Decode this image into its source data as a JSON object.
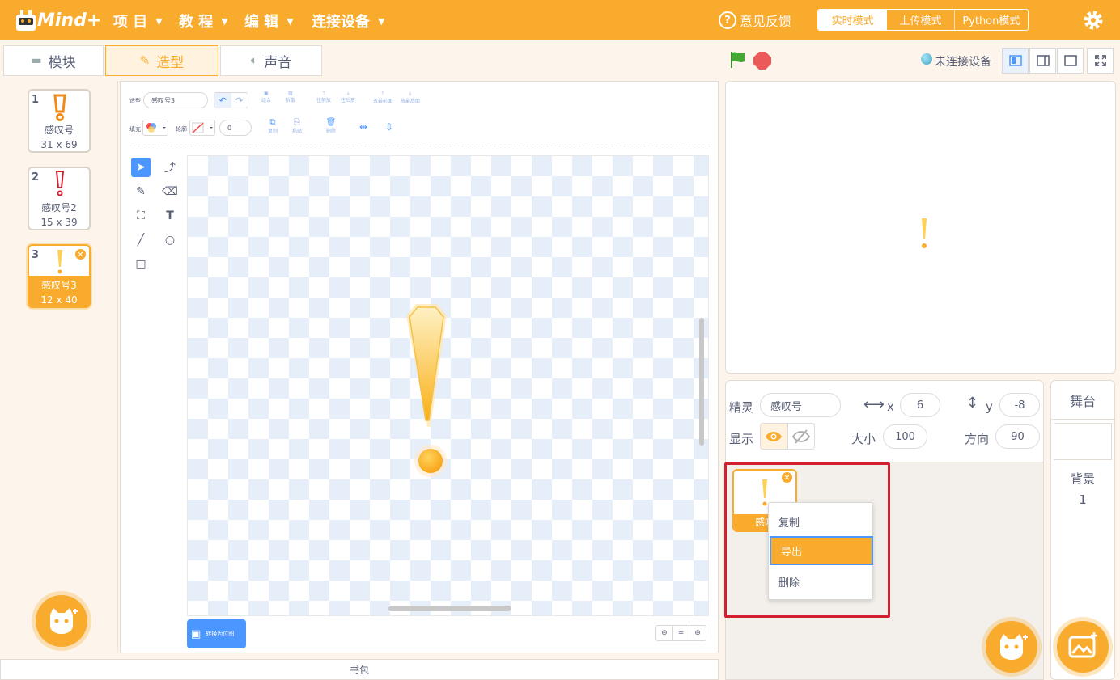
{
  "topbar": {
    "logo_text": "Mind+",
    "menus": [
      "项 目",
      "教 程",
      "编 辑",
      "连接设备"
    ],
    "feedback": "意见反馈",
    "modes": [
      "实时模式",
      "上传模式",
      "Python模式"
    ]
  },
  "tabs": {
    "blocks": "模块",
    "costumes": "造型",
    "sounds": "声音"
  },
  "costumes": [
    {
      "num": "1",
      "name": "感叹号",
      "size": "31 x 69"
    },
    {
      "num": "2",
      "name": "感叹号2",
      "size": "15 x 39"
    },
    {
      "num": "3",
      "name": "感叹号3",
      "size": "12 x 40"
    }
  ],
  "editor": {
    "costume_label": "造型",
    "costume_name": "感叹号3",
    "fill_label": "填充",
    "outline_label": "轮廓",
    "outline_width": "0",
    "group_label": "组合",
    "ungroup_label": "拆散",
    "forward_label": "往前放",
    "backward_label": "往后放",
    "front_label": "放最前面",
    "back_label": "放最后面",
    "copy_label": "复制",
    "paste_label": "粘贴",
    "delete_label": "删除",
    "convert_bitmap": "转换为位图"
  },
  "stage_header": {
    "connection": "未连接设备"
  },
  "sprite_info": {
    "sprite_label": "精灵",
    "sprite_name": "感叹号",
    "x_label": "x",
    "x_value": "6",
    "y_label": "y",
    "y_value": "-8",
    "show_label": "显示",
    "size_label": "大小",
    "size_value": "100",
    "direction_label": "方向",
    "direction_value": "90"
  },
  "sprite_tile": {
    "name": "感叹"
  },
  "context_menu": {
    "items": [
      "复制",
      "导出",
      "删除"
    ]
  },
  "stage_panel": {
    "title": "舞台",
    "backdrop_label": "背景",
    "backdrop_count": "1"
  },
  "backpack": "书包",
  "colors": {
    "accent": "#f9ab2d",
    "highlight_box": "#d3202f",
    "blue": "#4c97ff"
  }
}
